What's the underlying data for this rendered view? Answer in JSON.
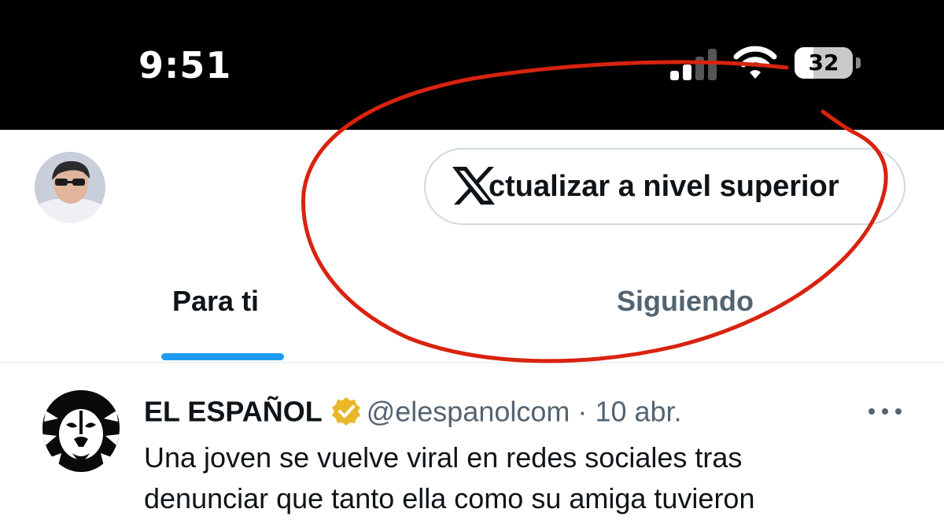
{
  "status_bar": {
    "time": "9:51",
    "battery_level": "32",
    "battery_fraction": 0.32
  },
  "header": {
    "upgrade_button_label": "ctualizar a nivel superior"
  },
  "tabs": [
    {
      "label": "Para ti",
      "active": true
    },
    {
      "label": "Siguiendo",
      "active": false
    }
  ],
  "tweet": {
    "author_name": "EL ESPAÑOL",
    "handle": "@elespanolcom",
    "separator": "·",
    "date": "10 abr.",
    "text_lines": [
      "Una joven se vuelve viral en redes sociales tras",
      "denunciar que tanto ella como su amiga tuvieron"
    ]
  },
  "colors": {
    "accent": "#1d9bf0",
    "verified_badge": "#e8b829",
    "annotation": "#d8230f"
  },
  "icons": [
    "signal-icon",
    "wifi-icon",
    "battery-icon",
    "x-logo-icon",
    "verified-badge-icon",
    "more-options-icon"
  ]
}
